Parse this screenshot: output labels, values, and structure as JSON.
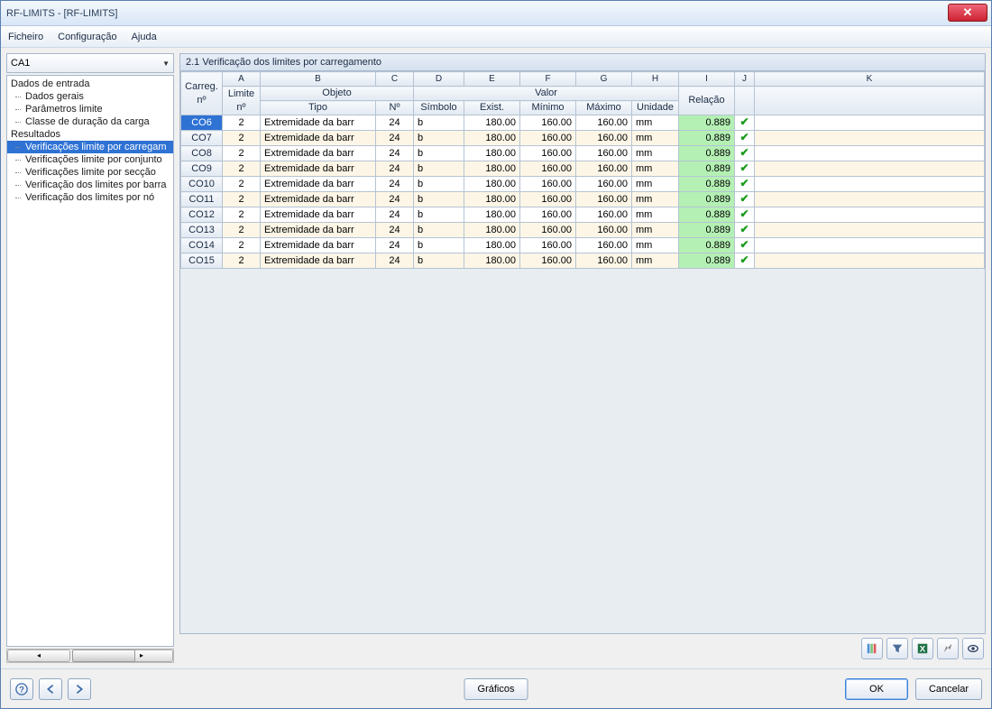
{
  "window": {
    "title": "RF-LIMITS - [RF-LIMITS]"
  },
  "menu": {
    "file": "Ficheiro",
    "config": "Configuração",
    "help": "Ajuda"
  },
  "combo": {
    "value": "CA1"
  },
  "tree": {
    "group1": "Dados de entrada",
    "g1_items": [
      "Dados gerais",
      "Parâmetros limite",
      "Classe de duração da carga"
    ],
    "group2": "Resultados",
    "g2_items": [
      "Verificações limite por carregam",
      "Verificações limite por conjunto",
      "Verificações limite por secção",
      "Verificação dos limites por barra",
      "Verificação dos limites por nó"
    ]
  },
  "panel": {
    "title": "2.1 Verificação dos limites por carregamento"
  },
  "columns": {
    "letters": [
      "A",
      "B",
      "C",
      "D",
      "E",
      "F",
      "G",
      "H",
      "I",
      "J",
      "K"
    ],
    "group_objeto": "Objeto",
    "group_valor": "Valor",
    "carreg": "Carreg.\nnº",
    "limite": "Limite\nnº",
    "tipo": "Tipo",
    "no": "Nº",
    "simbolo": "Símbolo",
    "exist": "Exist.",
    "minimo": "Mínimo",
    "maximo": "Máximo",
    "unidade": "Unidade",
    "relacao": "Relação"
  },
  "rows": [
    {
      "id": "CO6",
      "limite": "2",
      "tipo": "Extremidade da barr",
      "no": "24",
      "simb": "b",
      "exist": "180.00",
      "min": "160.00",
      "max": "160.00",
      "un": "mm",
      "rel": "0.889"
    },
    {
      "id": "CO7",
      "limite": "2",
      "tipo": "Extremidade da barr",
      "no": "24",
      "simb": "b",
      "exist": "180.00",
      "min": "160.00",
      "max": "160.00",
      "un": "mm",
      "rel": "0.889"
    },
    {
      "id": "CO8",
      "limite": "2",
      "tipo": "Extremidade da barr",
      "no": "24",
      "simb": "b",
      "exist": "180.00",
      "min": "160.00",
      "max": "160.00",
      "un": "mm",
      "rel": "0.889"
    },
    {
      "id": "CO9",
      "limite": "2",
      "tipo": "Extremidade da barr",
      "no": "24",
      "simb": "b",
      "exist": "180.00",
      "min": "160.00",
      "max": "160.00",
      "un": "mm",
      "rel": "0.889"
    },
    {
      "id": "CO10",
      "limite": "2",
      "tipo": "Extremidade da barr",
      "no": "24",
      "simb": "b",
      "exist": "180.00",
      "min": "160.00",
      "max": "160.00",
      "un": "mm",
      "rel": "0.889"
    },
    {
      "id": "CO11",
      "limite": "2",
      "tipo": "Extremidade da barr",
      "no": "24",
      "simb": "b",
      "exist": "180.00",
      "min": "160.00",
      "max": "160.00",
      "un": "mm",
      "rel": "0.889"
    },
    {
      "id": "CO12",
      "limite": "2",
      "tipo": "Extremidade da barr",
      "no": "24",
      "simb": "b",
      "exist": "180.00",
      "min": "160.00",
      "max": "160.00",
      "un": "mm",
      "rel": "0.889"
    },
    {
      "id": "CO13",
      "limite": "2",
      "tipo": "Extremidade da barr",
      "no": "24",
      "simb": "b",
      "exist": "180.00",
      "min": "160.00",
      "max": "160.00",
      "un": "mm",
      "rel": "0.889"
    },
    {
      "id": "CO14",
      "limite": "2",
      "tipo": "Extremidade da barr",
      "no": "24",
      "simb": "b",
      "exist": "180.00",
      "min": "160.00",
      "max": "160.00",
      "un": "mm",
      "rel": "0.889"
    },
    {
      "id": "CO15",
      "limite": "2",
      "tipo": "Extremidade da barr",
      "no": "24",
      "simb": "b",
      "exist": "180.00",
      "min": "160.00",
      "max": "160.00",
      "un": "mm",
      "rel": "0.889"
    }
  ],
  "buttons": {
    "graficos": "Gráficos",
    "ok": "OK",
    "cancelar": "Cancelar"
  },
  "icons": {
    "help": "help-icon",
    "prev": "prev-icon",
    "next": "next-icon",
    "tb1": "color-scale-icon",
    "tb2": "filter-icon",
    "tb3": "export-excel-icon",
    "tb4": "pick-icon",
    "tb5": "view-icon"
  }
}
